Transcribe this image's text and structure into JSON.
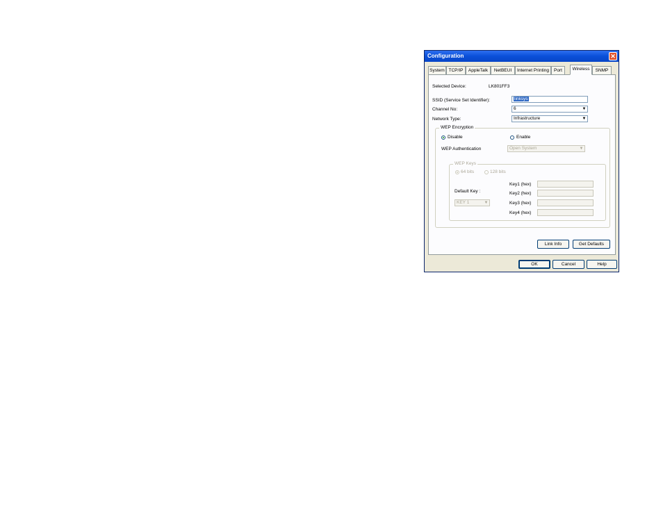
{
  "window": {
    "title": "Configuration",
    "close_icon": "close-icon",
    "accent_color": "#0a4fd8",
    "close_color": "#e0542e"
  },
  "tabs": [
    {
      "label": "System"
    },
    {
      "label": "TCP/IP"
    },
    {
      "label": "AppleTalk"
    },
    {
      "label": "NetBEUI"
    },
    {
      "label": "Internet Printing"
    },
    {
      "label": "Port"
    },
    {
      "label": "Wireless",
      "active": true
    },
    {
      "label": "SNMP"
    }
  ],
  "wireless": {
    "selected_device_label": "Selected Device:",
    "selected_device_value": "LK801FF3",
    "ssid_label": "SSID (Service Set Identifier):",
    "ssid_value": "linksys",
    "channel_label": "Channel No:",
    "channel_value": "6",
    "network_type_label": "Network Type:",
    "network_type_value": "Infrastructure",
    "wep": {
      "group_title": "WEP Encryption",
      "disable_label": "Disable",
      "enable_label": "Enable",
      "selected": "Disable",
      "auth_label": "WEP Authentication",
      "auth_value": "Open System"
    },
    "keys": {
      "group_title": "WEP Keys",
      "bits64_label": "64 bits",
      "bits128_label": "128 bits",
      "default_key_label": "Default Key :",
      "default_key_value": "KEY 1",
      "key_labels": [
        "Key1 (hex)",
        "Key2 (hex)",
        "Key3 (hex)",
        "Key4 (hex)"
      ],
      "key_values": [
        "",
        "",
        "",
        ""
      ]
    },
    "link_info_label": "Link Info",
    "get_defaults_label": "Get Defaults"
  },
  "footer": {
    "ok_label": "OK",
    "cancel_label": "Cancel",
    "help_label": "Help"
  }
}
